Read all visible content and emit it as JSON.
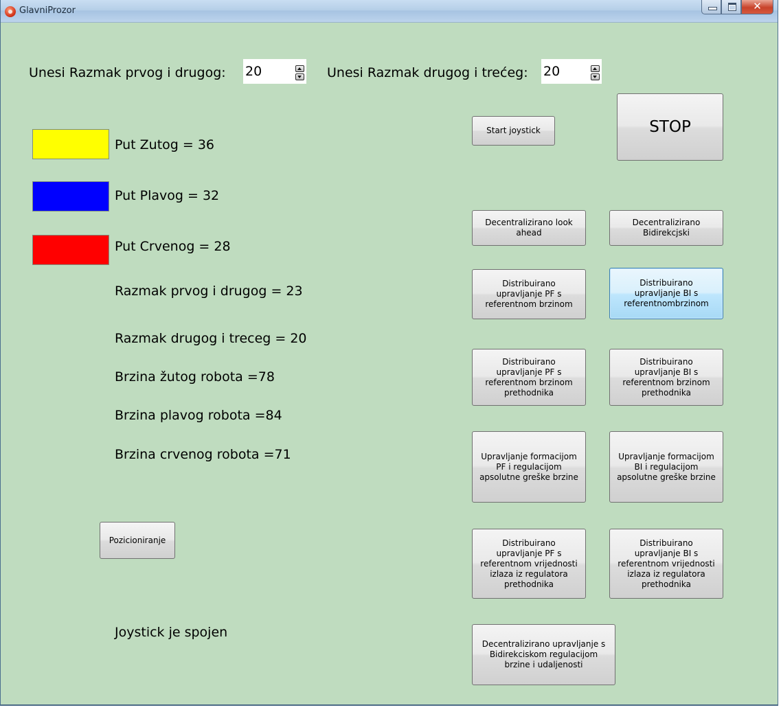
{
  "window": {
    "title": "GlavniProzor",
    "icon": "app-red-icon"
  },
  "controls": {
    "minimize": "minimize-icon",
    "maximize": "maximize-icon",
    "close": "✕"
  },
  "spacing": {
    "label1": "Unesi Razmak prvog i drugog:",
    "value1": "20",
    "label2": "Unesi Razmak drugog i trećeg:",
    "value2": "20"
  },
  "paths": [
    {
      "label": "Put Zutog = 36",
      "color": "#ffff00"
    },
    {
      "label": "Put Plavog = 32",
      "color": "#0000ff"
    },
    {
      "label": "Put Crvenog = 28",
      "color": "#ff0000"
    }
  ],
  "stats": [
    "Razmak prvog i drugog = 23",
    "Razmak drugog i treceg = 20",
    "Brzina žutog robota =78",
    "Brzina plavog robota =84",
    "Brzina crvenog robota =71"
  ],
  "status": "Joystick je spojen",
  "buttons": {
    "start_joystick": "Start joystick",
    "stop": "STOP",
    "pozicioniranje": "Pozicioniranje",
    "dec_look_ahead": [
      "Decentralizirano look",
      "ahead"
    ],
    "dec_bidir": [
      "Decentralizirano",
      "Bidirekcjski"
    ],
    "dist_pf_ref": [
      "Distribuirano",
      "upravljanje PF s",
      "referentnom brzinom"
    ],
    "dist_bi_ref": [
      "Distribuirano",
      "upravljanje BI s",
      "referentnombrzinom"
    ],
    "dist_pf_pred": [
      "Distribuirano",
      "upravljanje PF s",
      "referentnom brzinom",
      "prethodnika"
    ],
    "dist_bi_pred": [
      "Distribuirano",
      "upravljanje BI s",
      "referentnom brzinom",
      "prethodnika"
    ],
    "form_pf": [
      "Upravljanje formacijom",
      "PF i regulacijom",
      "apsolutne greške brzine"
    ],
    "form_bi": [
      "Upravljanje formacijom",
      "BI i regulacijom",
      "apsolutne greške brzine"
    ],
    "dist_pf_reg": [
      "Distribuirano",
      "upravljanje PF s",
      "referentnom vrijednosti",
      "izlaza iz regulatora",
      "prethodnika"
    ],
    "dist_bi_reg": [
      "Distribuirano",
      "upravljanje BI s",
      "referentnom vrijednosti",
      "izlaza iz regulatora",
      "prethodnika"
    ],
    "dec_bidir_reg": [
      "Decentralizirano upravljanje s",
      "Bidirekciskom regulacijom",
      "brzine i udaljenosti"
    ]
  }
}
